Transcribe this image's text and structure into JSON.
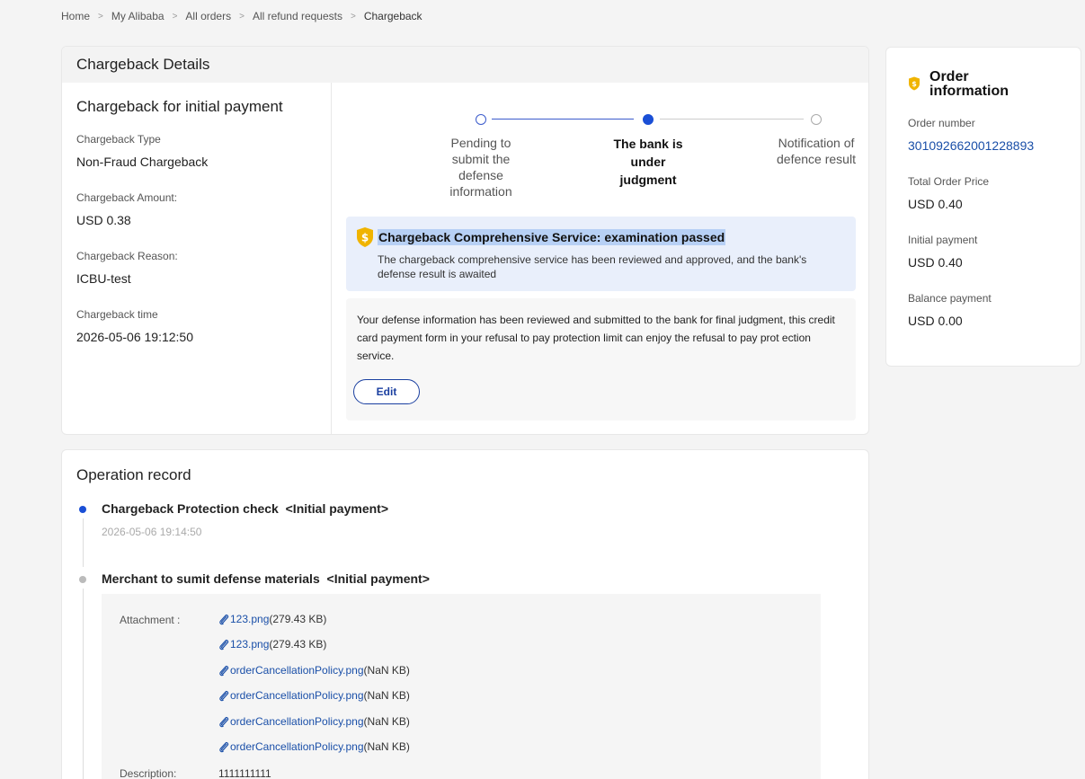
{
  "breadcrumb": [
    "Home",
    "My Alibaba",
    "All orders",
    "All refund requests",
    "Chargeback"
  ],
  "details": {
    "header": "Chargeback Details",
    "section_title": "Chargeback for initial payment",
    "fields": [
      {
        "label": "Chargeback Type",
        "value": "Non-Fraud Chargeback"
      },
      {
        "label": "Chargeback Amount:",
        "value": "USD 0.38"
      },
      {
        "label": "Chargeback Reason:",
        "value": "ICBU-test"
      },
      {
        "label": "Chargeback time",
        "value": "2026-05-06 19:12:50"
      }
    ],
    "steps": [
      {
        "label": "Pending to submit the defense information",
        "state": "done"
      },
      {
        "label": "The bank is under judgment",
        "state": "active"
      },
      {
        "label": "Notification of defence result",
        "state": "pending"
      }
    ],
    "service": {
      "title": "Chargeback Comprehensive Service:  examination passed",
      "description": "The chargeback comprehensive service has been reviewed and approved, and the bank's defense result is awaited"
    },
    "defense": {
      "text": "Your defense information has been reviewed and submitted to the bank for final judgment, this credit card payment form in your refusal to pay protection limit can enjoy the refusal to pay prot ection service.",
      "edit_label": "Edit"
    }
  },
  "order": {
    "title": "Order information",
    "fields": [
      {
        "label": "Order number",
        "value": "301092662001228893"
      },
      {
        "label": "Total Order Price",
        "value": "USD 0.40"
      },
      {
        "label": "Initial payment",
        "value": "USD 0.40"
      },
      {
        "label": "Balance payment",
        "value": "USD 0.00"
      }
    ]
  },
  "record": {
    "title": "Operation record",
    "entries": [
      {
        "title": "Chargeback Protection check  <Initial payment>",
        "time": "2026-05-06 19:14:50"
      },
      {
        "title": "Merchant to sumit defense materials  <Initial payment>"
      }
    ],
    "attachment_label": "Attachment :",
    "attachments": [
      {
        "name": "123.png",
        "size": "(279.43 KB)"
      },
      {
        "name": "123.png",
        "size": "(279.43 KB)"
      },
      {
        "name": "orderCancellationPolicy.png",
        "size": "(NaN KB)"
      },
      {
        "name": "orderCancellationPolicy.png",
        "size": "(NaN KB)"
      },
      {
        "name": "orderCancellationPolicy.png",
        "size": "(NaN KB)"
      },
      {
        "name": "orderCancellationPolicy.png",
        "size": "(NaN KB)"
      }
    ],
    "description_label": "Description:",
    "description_value": "1111111111"
  },
  "colors": {
    "accent": "#1a4fd6",
    "link": "#1a4fa8",
    "shield": "#f0b400"
  },
  "icons": {
    "service": "shield-dollar-icon",
    "order": "shield-dollar-icon",
    "attachment": "paperclip-icon"
  }
}
